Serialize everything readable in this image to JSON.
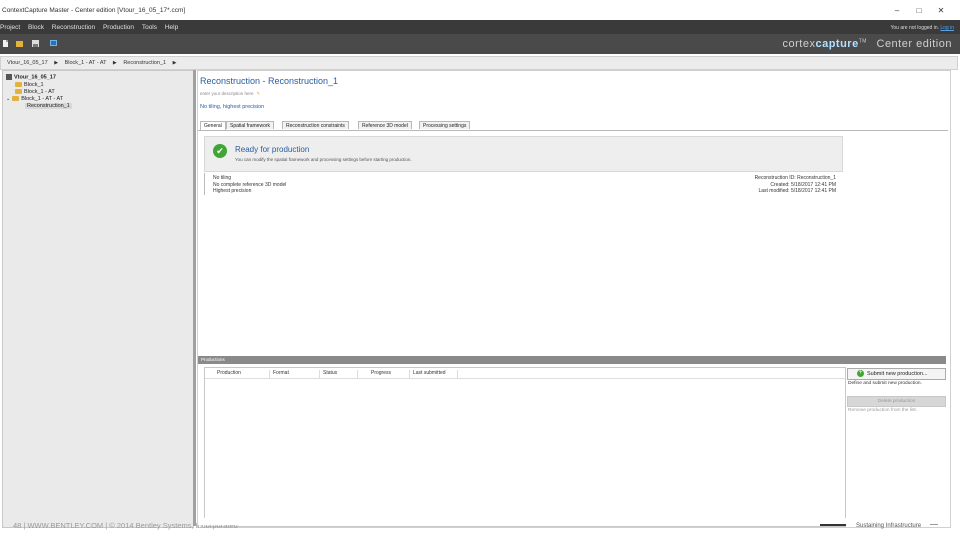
{
  "window": {
    "title": "ContextCapture Master - Center edition [Vtour_16_05_17*.ccm]",
    "controls": [
      "–",
      "□",
      "✕"
    ]
  },
  "menu": {
    "items": [
      "Project",
      "Block",
      "Reconstruction",
      "Production",
      "Tools",
      "Help"
    ],
    "login_text": "You are not logged in.",
    "login_link": "Log in"
  },
  "toolbar": {
    "icons": [
      "new-project-icon",
      "open-folder-icon",
      "save-icon",
      "settings-icon"
    ]
  },
  "brand": {
    "prefix": "cortex",
    "product": "capture",
    "tm": "TM",
    "edition": "Center edition"
  },
  "breadcrumb": [
    "Vtour_16_05_17",
    "Block_1 - AT - AT",
    "Reconstruction_1"
  ],
  "tree": {
    "root": "Vtour_16_05_17",
    "children": [
      "Block_1",
      "Block_1 - AT",
      "Block_1 - AT - AT"
    ],
    "leaf": "Reconstruction_1"
  },
  "reconstruction": {
    "title": "Reconstruction - Reconstruction_1",
    "description_placeholder": "enter your description here",
    "subtitle": "No tiling, highest precision"
  },
  "tabs": [
    "General",
    "Spatial framework",
    "Reconstruction constraints",
    "Reference 3D model",
    "Processing settings"
  ],
  "status": {
    "heading": "Ready for production",
    "text": "You can modify the spatial framework and processing settings before starting production."
  },
  "info_left": [
    "No tiling",
    "No complete reference 3D model",
    "Highest precision"
  ],
  "info_right": [
    "Reconstruction ID: Reconstruction_1",
    "Created: 5/18/2017 12:41 PM",
    "Last modified: 5/18/2017 12:41 PM"
  ],
  "productions": {
    "header": "Productions",
    "columns": [
      "Production",
      "Format",
      "Status",
      "Progress",
      "Last submitted"
    ]
  },
  "actions": {
    "submit_label": "Submit new production...",
    "submit_hint": "Define and submit new production.",
    "delete_label": "Delete production",
    "delete_hint": "Remove production from the list."
  },
  "footer": {
    "left": "48  |  WWW.BENTLEY.COM  |  © 2014 Bentley Systems, Incorporated",
    "right": "Sustaining Infrastructure"
  }
}
